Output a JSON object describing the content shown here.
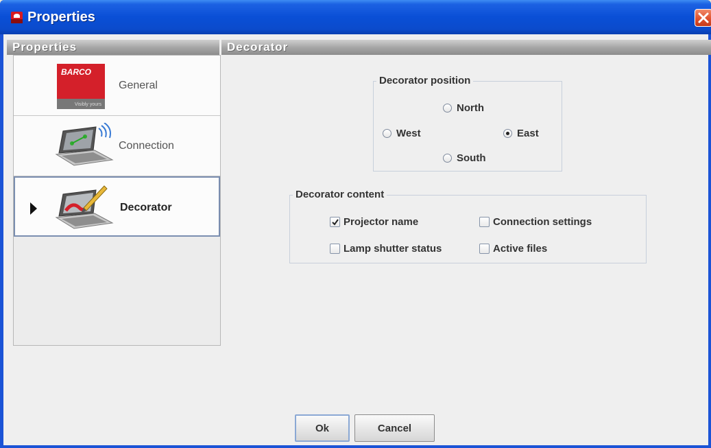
{
  "window": {
    "title": "Properties"
  },
  "left_panel": {
    "header": "Properties"
  },
  "nav": {
    "items": [
      {
        "label": "General",
        "icon": "barco-logo-icon",
        "selected": false
      },
      {
        "label": "Connection",
        "icon": "laptop-wifi-icon",
        "selected": false
      },
      {
        "label": "Decorator",
        "icon": "laptop-paint-icon",
        "selected": true
      }
    ],
    "logo_text": "BARCO",
    "logo_tagline": "Visibly yours"
  },
  "content": {
    "header": "Decorator",
    "position_group": {
      "title": "Decorator position",
      "options": {
        "north": "North",
        "west": "West",
        "east": "East",
        "south": "South"
      },
      "selected": "East"
    },
    "content_group": {
      "title": "Decorator content",
      "options": [
        {
          "label": "Projector name",
          "checked": true
        },
        {
          "label": "Connection settings",
          "checked": false
        },
        {
          "label": "Lamp shutter status",
          "checked": false
        },
        {
          "label": "Active files",
          "checked": false
        }
      ]
    }
  },
  "buttons": {
    "ok": "Ok",
    "cancel": "Cancel"
  },
  "colors": {
    "titlebar": "#0a4fd6",
    "brand_red": "#d4202a",
    "close": "#e0522f"
  }
}
